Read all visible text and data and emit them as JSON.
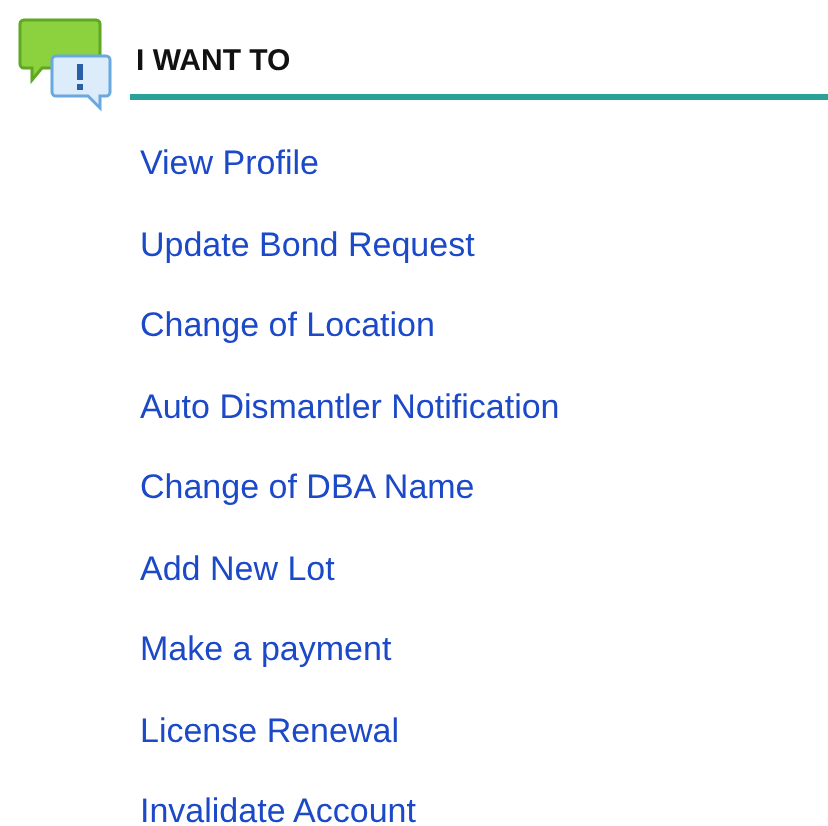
{
  "title": "I WANT TO",
  "links": [
    "View Profile",
    "Update Bond Request",
    "Change of Location",
    "Auto Dismantler Notification",
    "Change of DBA Name",
    "Add New Lot",
    "Make a payment",
    "License Renewal",
    "Invalidate Account"
  ]
}
